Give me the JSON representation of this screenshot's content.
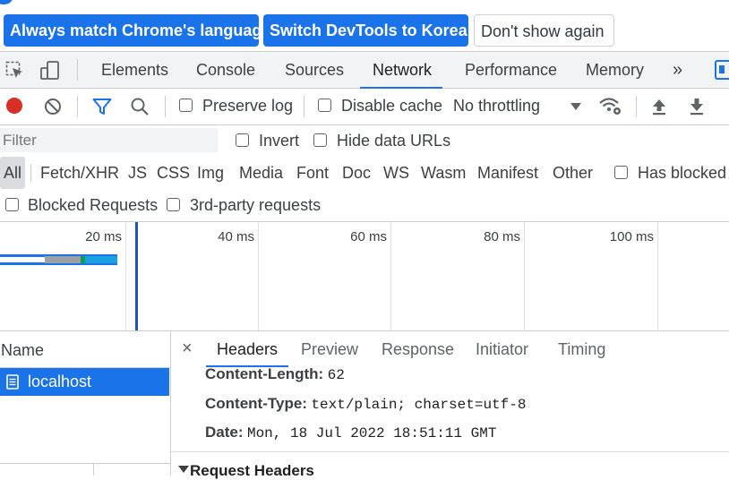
{
  "banner": {
    "match_language_label": "Always match Chrome's language",
    "switch_language_label": "Switch DevTools to Korean",
    "dont_show_label": "Don't show again"
  },
  "main_tabs": {
    "elements": "Elements",
    "console": "Console",
    "sources": "Sources",
    "network": "Network",
    "performance": "Performance",
    "memory": "Memory",
    "more": "»"
  },
  "toolbar": {
    "preserve_log": "Preserve log",
    "disable_cache": "Disable cache",
    "throttling": "No throttling"
  },
  "filter": {
    "placeholder": "Filter",
    "invert": "Invert",
    "hide_data_urls": "Hide data URLs"
  },
  "types": [
    "All",
    "Fetch/XHR",
    "JS",
    "CSS",
    "Img",
    "Media",
    "Font",
    "Doc",
    "WS",
    "Wasm",
    "Manifest",
    "Other"
  ],
  "has_blocked_cookies": "Has blocked",
  "blocked_requests": "Blocked Requests",
  "third_party_requests": "3rd-party requests",
  "overview": {
    "ticks": [
      "20 ms",
      "40 ms",
      "60 ms",
      "80 ms",
      "100 ms"
    ]
  },
  "requests": {
    "column_name": "Name",
    "rows": [
      "localhost"
    ]
  },
  "detail": {
    "close": "×",
    "tabs": [
      "Headers",
      "Preview",
      "Response",
      "Initiator",
      "Timing"
    ],
    "headers": [
      {
        "name": "Content-Length:",
        "value": "62"
      },
      {
        "name": "Content-Type:",
        "value": "text/plain; charset=utf-8"
      },
      {
        "name": "Date:",
        "value": "Mon, 18 Jul 2022 18:51:11 GMT"
      }
    ],
    "section_title": "Request Headers"
  },
  "colors": {
    "accent": "#1a73e8",
    "record": "#d93025",
    "selected_row": "#1a73e8"
  }
}
